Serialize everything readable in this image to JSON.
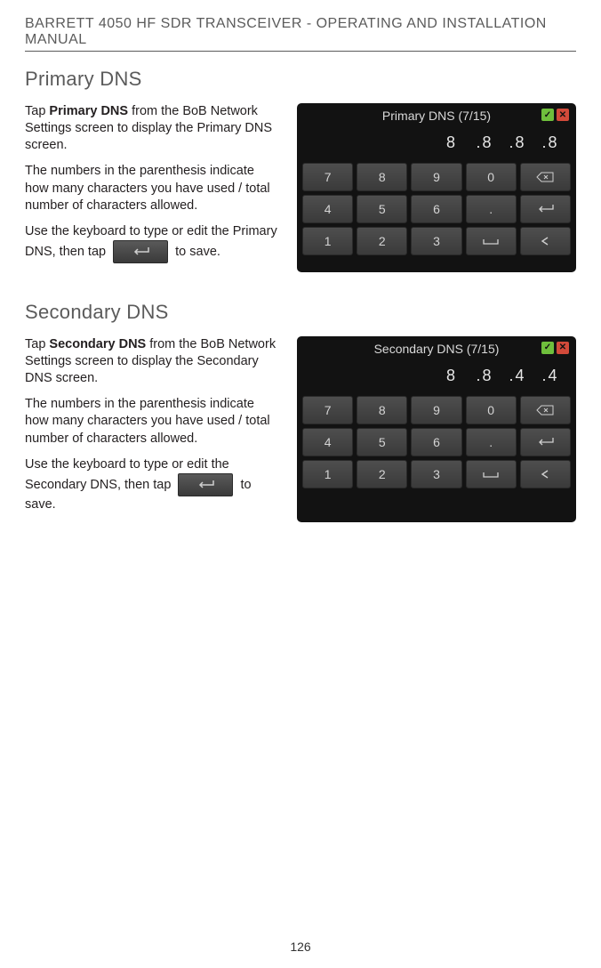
{
  "header": "BARRETT 4050 HF SDR TRANSCEIVER - OPERATING AND INSTALLATION MANUAL",
  "page_number": "126",
  "sections": [
    {
      "heading": "Primary DNS",
      "para1a": "Tap ",
      "para1b": "Primary DNS",
      "para1c": " from the BoB Net­work Settings screen to display the Primary DNS screen.",
      "para2": "The numbers in the parenthesis indi­cate how many characters you have used / total number of characters allowed.",
      "para3a": "Use the keyboard to type or edit the Primary DNS, then tap ",
      "para3b": " to save.",
      "device": {
        "title": "Primary DNS (7/15)",
        "ip": [
          "8",
          ".8",
          ".8",
          ".8"
        ]
      }
    },
    {
      "heading": "Secondary DNS",
      "para1a": "Tap ",
      "para1b": "Secondary DNS",
      "para1c": " from the BoB Network Settings screen to display the Secondary DNS screen.",
      "para2": "The numbers in the parenthesis indi­cate how many characters you have used / total number of characters allowed.",
      "para3a": "Use the keyboard to type or edit the Secondary DNS, then tap ",
      "para3b": " to save.",
      "device": {
        "title": "Secondary DNS (7/15)",
        "ip": [
          "8",
          ".8",
          ".4",
          ".4"
        ]
      }
    }
  ],
  "keypad_rows": [
    [
      "7",
      "8",
      "9",
      "0",
      "bksp"
    ],
    [
      "4",
      "5",
      "6",
      ".",
      "enter"
    ],
    [
      "1",
      "2",
      "3",
      "space",
      "left"
    ]
  ],
  "icons": {
    "ok": "✓",
    "close": "✕"
  }
}
